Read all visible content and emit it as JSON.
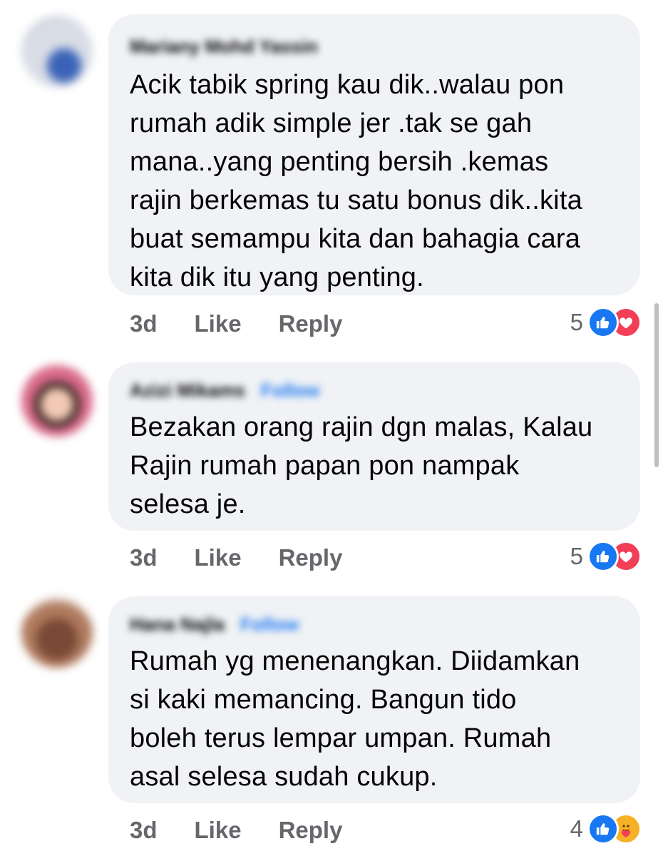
{
  "comments": [
    {
      "author": "Mariany Mohd Yassin",
      "follow": "",
      "text": "Acik tabik spring kau dik..walau pon\nrumah adik simple jer .tak se gah\nmana..yang penting bersih .kemas\nrajin berkemas tu satu bonus dik..kita\nbuat semampu kita dan bahagia cara\nkita dik itu yang penting.",
      "time": "3d",
      "like": "Like",
      "reply": "Reply",
      "reaction_count": "5",
      "reactions": [
        "like-icon",
        "love-icon"
      ]
    },
    {
      "author": "Azizi Mikams",
      "follow": "Follow",
      "text": "Bezakan orang rajin dgn malas, Kalau\nRajin rumah papan pon nampak\nselesa je.",
      "time": "3d",
      "like": "Like",
      "reply": "Reply",
      "reaction_count": "5",
      "reactions": [
        "like-icon",
        "love-icon"
      ]
    },
    {
      "author": "Hana Najla",
      "follow": "Follow",
      "text": "Rumah yg menenangkan. Diidamkan\nsi kaki memancing. Bangun tido\nboleh terus lempar umpan. Rumah\nasal selesa sudah cukup.",
      "time": "3d",
      "like": "Like",
      "reply": "Reply",
      "reaction_count": "4",
      "reactions": [
        "like-icon",
        "care-icon"
      ]
    }
  ],
  "colors": {
    "bubble": "#f0f2f5",
    "meta_text": "#65676b",
    "like_blue": "#1877f2",
    "love_red": "#f33e58",
    "care_yellow": "#f7b125"
  }
}
